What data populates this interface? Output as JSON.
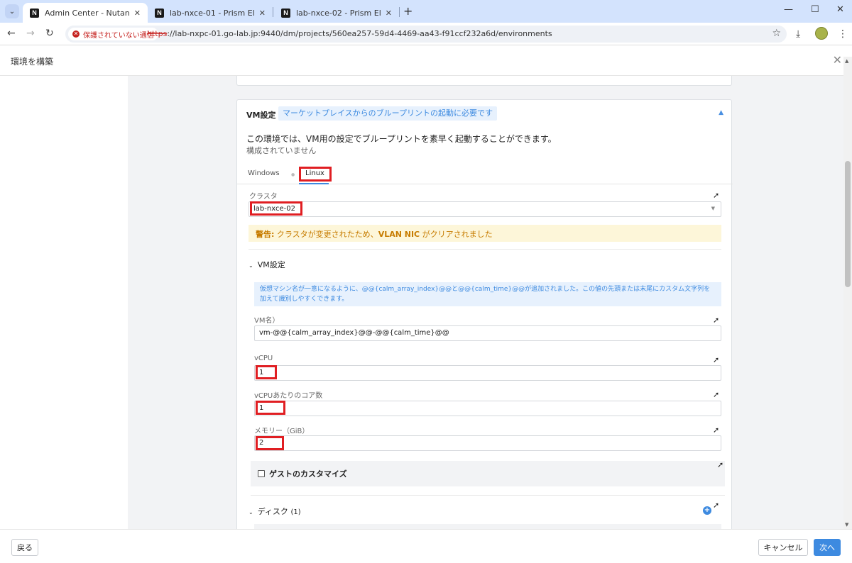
{
  "browser": {
    "tabs": [
      {
        "title": "Admin Center - Nutanix",
        "favicon": "N"
      },
      {
        "title": "lab-nxce-01 - Prism Element",
        "favicon": "N"
      },
      {
        "title": "lab-nxce-02 - Prism Element",
        "favicon": "N"
      }
    ],
    "security_label": "保護されていない通信",
    "url_scheme": "https",
    "url_rest": "://lab-nxpc-01.go-lab.jp:9440/dm/projects/560ea257-59d4-4469-aa43-f91ccf232a6d/environments"
  },
  "app": {
    "title": "環境を構築"
  },
  "vm_settings": {
    "title": "VM設定",
    "badge": "マーケットプレイスからのブループリントの起動に必要です",
    "description": "この環境では、VM用の設定でブループリントを素早く起動することができます。",
    "status": "構成されていません",
    "os_tabs": [
      "Windows",
      "Linux"
    ],
    "active_os": "Linux",
    "cluster_label": "クラスタ",
    "cluster_value": "lab-nxce-02",
    "warning_prefix": "警告:",
    "warning_text": " クラスタが変更されたため、",
    "warning_bold": "VLAN NIC",
    "warning_suffix": " がクリアされました",
    "sub_title": "VM設定",
    "info_text": "仮想マシン名が一意になるように、@@{calm_array_index}@@と@@{calm_time}@@が追加されました。この値の先頭または末尾にカスタム文字列を加えて識別しやすくできます。",
    "vm_name_label": "VM名）",
    "vm_name_value": "vm-@@{calm_array_index}@@-@@{calm_time}@@",
    "vcpu_label": "vCPU",
    "vcpu_value": "1",
    "cores_label": "vCPUあたりのコア数",
    "cores_value": "1",
    "memory_label": "メモリー（GiB）",
    "memory_value": "2",
    "guest_label": "ゲストのカスタマイズ",
    "disk_label": "ディスク",
    "disk_count": "(1)"
  },
  "footer": {
    "back_label": "戻る",
    "cancel_label": "キャンセル",
    "next_label": "次へ"
  }
}
